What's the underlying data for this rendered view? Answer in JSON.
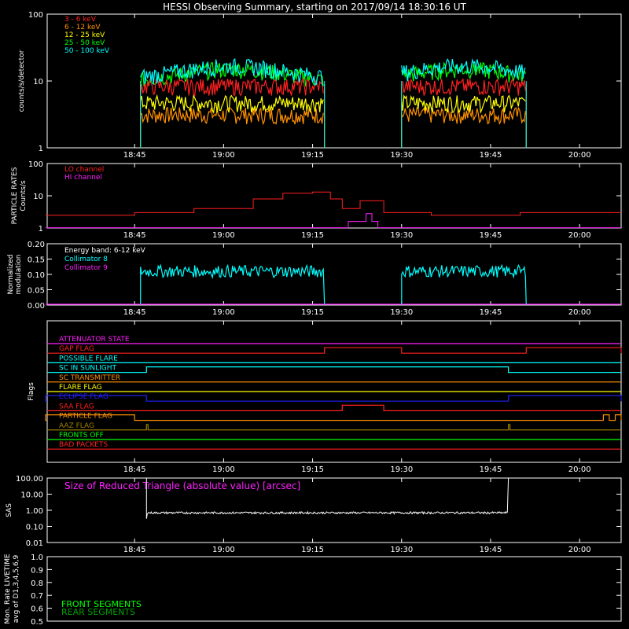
{
  "title": "HESSI Observing Summary, starting on 2017/09/14 18:30:16 UT",
  "time_ticks": [
    "18:45",
    "19:00",
    "19:15",
    "19:30",
    "19:45",
    "20:00"
  ],
  "colors": {
    "background": "#000000",
    "axis": "#ffffff",
    "band_3_6": "#ff2020",
    "band_6_12": "#ff9000",
    "band_12_25": "#ffff00",
    "band_25_50": "#00ff00",
    "band_50_100": "#00ffff",
    "lo_channel": "#ff2020",
    "hi_channel": "#ff20ff",
    "collimator_8": "#00ffff",
    "collimator_9": "#ff20ff",
    "sas": "#ffffff",
    "front_segments": "#00ff00",
    "rear_segments": "#00a000"
  },
  "chart_data": [
    {
      "panel": "count_rates",
      "type": "line",
      "ylabel": "counts/s/detector",
      "yscale": "log",
      "ylim": [
        1,
        100
      ],
      "yticks": [
        "1",
        "10",
        "100"
      ],
      "x_minutes_after_start": "18:30 to 20:07",
      "series": [
        {
          "name": "3 - 6 keV",
          "segments": [
            [
              "18:46",
              "19:17",
              8
            ],
            [
              "19:30",
              "19:51",
              8
            ]
          ]
        },
        {
          "name": "6 - 12 keV",
          "segments": [
            [
              "18:46",
              "19:17",
              3
            ],
            [
              "19:30",
              "19:51",
              3
            ]
          ]
        },
        {
          "name": "12 - 25 keV",
          "segments": [
            [
              "18:46",
              "19:17",
              4.5
            ],
            [
              "19:30",
              "19:51",
              4.5
            ]
          ]
        },
        {
          "name": "25 - 50 keV",
          "segments": [
            [
              "18:46",
              "19:17",
              9
            ],
            [
              "19:30",
              "19:51",
              9
            ]
          ]
        },
        {
          "name": "50 - 100 keV",
          "segments": [
            [
              "18:46",
              "19:17",
              10
            ],
            [
              "19:30",
              "19:51",
              10
            ]
          ]
        }
      ]
    },
    {
      "panel": "particle_rates",
      "type": "line",
      "ylabel_lines": [
        "PARTICLE RATES",
        "Counts/s"
      ],
      "yscale": "log",
      "ylim": [
        1,
        100
      ],
      "yticks": [
        "1",
        "10",
        "100"
      ],
      "series": [
        {
          "name": "LO channel",
          "points": [
            [
              "18:30",
              2.5
            ],
            [
              "18:45",
              3
            ],
            [
              "18:55",
              4
            ],
            [
              "19:05",
              8
            ],
            [
              "19:10",
              12
            ],
            [
              "19:15",
              13
            ],
            [
              "19:18",
              8
            ],
            [
              "19:20",
              4
            ],
            [
              "19:23",
              7
            ],
            [
              "19:27",
              3
            ],
            [
              "19:35",
              2.5
            ],
            [
              "19:50",
              3
            ],
            [
              "20:00",
              3
            ],
            [
              "20:07",
              3
            ]
          ]
        },
        {
          "name": "HI channel",
          "points": [
            [
              "18:30",
              1
            ],
            [
              "19:20",
              1
            ],
            [
              "19:21",
              1.6
            ],
            [
              "19:24",
              2.8
            ],
            [
              "19:25",
              1.6
            ],
            [
              "19:26",
              1
            ],
            [
              "20:07",
              1
            ]
          ]
        }
      ]
    },
    {
      "panel": "modulation",
      "type": "line",
      "ylabel_lines": [
        "Normalized",
        "modulation"
      ],
      "ylim": [
        0,
        0.2
      ],
      "yticks": [
        "0.00",
        "0.05",
        "0.10",
        "0.15",
        "0.20"
      ],
      "annotation": "Energy band: 6-12 keV",
      "series": [
        {
          "name": "Collimator 8",
          "segments": [
            [
              "18:46",
              "19:17",
              0.11
            ],
            [
              "19:30",
              "19:51",
              0.11
            ]
          ]
        },
        {
          "name": "Collimator 9",
          "segments": [
            [
              "18:30",
              "20:07",
              0.0
            ]
          ]
        }
      ]
    },
    {
      "panel": "flags",
      "type": "line",
      "ylabel": "Flags",
      "flags": [
        {
          "name": "ATTENUATOR STATE",
          "color": "#ff20ff",
          "steps": []
        },
        {
          "name": "GAP FLAG",
          "color": "#ff2020",
          "steps": [
            [
              "19:17",
              "19:30"
            ],
            [
              "19:51",
              "20:07"
            ]
          ]
        },
        {
          "name": "POSSIBLE FLARE",
          "color": "#00ffff",
          "steps": []
        },
        {
          "name": "SC IN SUNLIGHT",
          "color": "#00ffff",
          "steps": [
            [
              "18:47",
              "19:48"
            ]
          ]
        },
        {
          "name": "SC TRANSMITTER",
          "color": "#ff9000",
          "steps": []
        },
        {
          "name": "FLARE FLAG",
          "color": "#ffff00",
          "steps": []
        },
        {
          "name": "ECLIPSE FLAG",
          "color": "#2020ff",
          "steps": [
            [
              "18:30",
              "18:47"
            ],
            [
              "19:48",
              "20:07"
            ]
          ]
        },
        {
          "name": "SAA FLAG",
          "color": "#ff2020",
          "steps": [
            [
              "19:20",
              "19:27"
            ]
          ]
        },
        {
          "name": "PARTICLE FLAG",
          "color": "#ff9000",
          "steps": [
            [
              "18:30",
              "18:45"
            ],
            [
              "20:04",
              "20:05"
            ],
            [
              "20:06",
              "20:07"
            ]
          ]
        },
        {
          "name": "AAZ FLAG",
          "color": "#a08000",
          "steps": [
            [
              "18:47",
              "18:47"
            ],
            [
              "19:48",
              "19:48"
            ]
          ]
        },
        {
          "name": "FRONTS OFF",
          "color": "#00ff00",
          "steps": []
        },
        {
          "name": "BAD PACKETS",
          "color": "#ff2020",
          "steps": []
        }
      ]
    },
    {
      "panel": "sas",
      "type": "line",
      "ylabel": "SAS",
      "yscale": "log",
      "ylim": [
        0.01,
        100
      ],
      "yticks": [
        "0.01",
        "0.10",
        "1.00",
        "10.00",
        "100.00"
      ],
      "annotation": "Size of Reduced Triangle (absolute value) [arcsec]",
      "series": [
        {
          "name": "SAS",
          "segments": [
            [
              "18:47",
              "19:48",
              0.7
            ]
          ]
        }
      ]
    },
    {
      "panel": "livetime",
      "type": "line",
      "ylabel_lines": [
        "Mon. Rate LIVETIME",
        "avg of D1,3,4,5,6,9"
      ],
      "ylim": [
        0.5,
        1.0
      ],
      "yticks": [
        "0.5",
        "0.6",
        "0.7",
        "0.8",
        "0.9",
        "1.0"
      ],
      "series": [
        {
          "name": "FRONT SEGMENTS",
          "values": []
        },
        {
          "name": "REAR SEGMENTS",
          "values": []
        }
      ]
    }
  ]
}
